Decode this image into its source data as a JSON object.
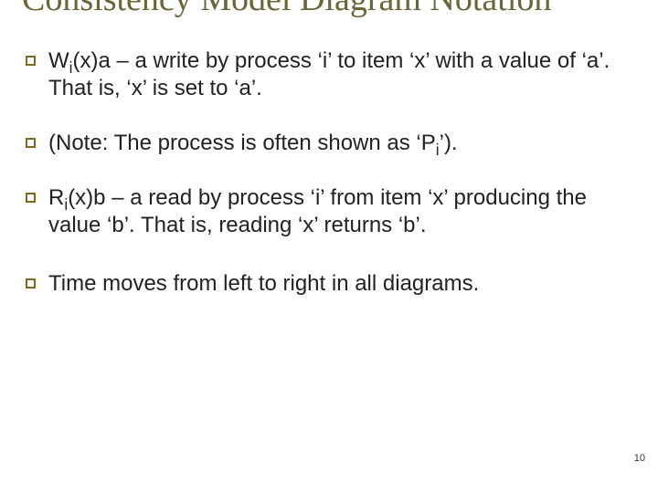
{
  "slide": {
    "title": "Consistency Model Diagram Notation",
    "number": "10"
  },
  "bullets": [
    {
      "segments": [
        {
          "text": "W",
          "sub": false
        },
        {
          "text": "i",
          "sub": true
        },
        {
          "text": "(x)a – a write by process ‘i’ to item ‘x’ with a value of ‘a’.  That is, ‘x’ is set to ‘a’.",
          "sub": false
        }
      ]
    },
    {
      "segments": [
        {
          "text": "(Note: The process is often shown as ‘P",
          "sub": false
        },
        {
          "text": "i",
          "sub": true
        },
        {
          "text": "’).",
          "sub": false
        }
      ]
    },
    {
      "segments": [
        {
          "text": "R",
          "sub": false
        },
        {
          "text": "i",
          "sub": true
        },
        {
          "text": "(x)b – a read by process ‘i’ from item ‘x’ producing the value ‘b’. That is, reading ‘x’ returns ‘b’.",
          "sub": false
        }
      ]
    },
    {
      "segments": [
        {
          "text": "Time moves from left to right in all diagrams.",
          "sub": false
        }
      ]
    }
  ]
}
